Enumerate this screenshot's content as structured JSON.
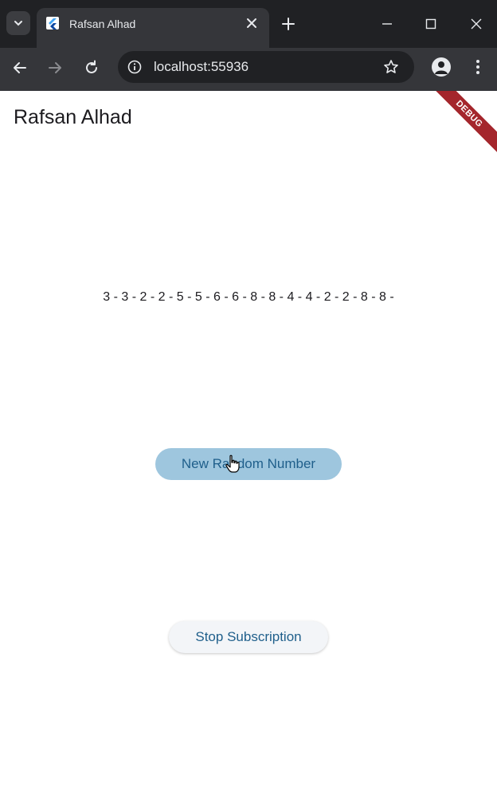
{
  "browser": {
    "tab": {
      "title": "Rafsan Alhad"
    },
    "address_bar": {
      "url": "localhost:55936"
    }
  },
  "app": {
    "title": "Rafsan Alhad",
    "debug_banner": "DEBUG",
    "numbers_text": "3 - 3 - 2 - 2 - 5 - 5 - 6 - 6 - 8 - 8 - 4 - 4 - 2 - 2 - 8 - 8 -",
    "new_random_button": "New Random Number",
    "stop_subscription_button": "Stop Subscription"
  },
  "colors": {
    "tab_strip": "#202124",
    "toolbar": "#35363a",
    "primary_button_bg": "#9ec6de",
    "button_text": "#1f5f8b",
    "debug_banner": "#a4262c"
  }
}
